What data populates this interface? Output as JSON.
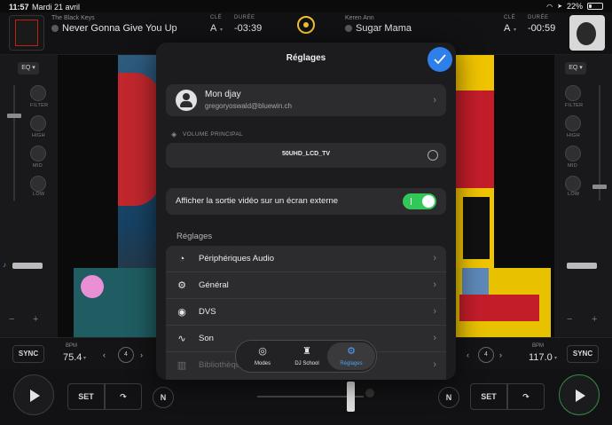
{
  "status": {
    "time": "11:57",
    "date": "Mardi 21 avril",
    "battery": "22%",
    "battery_level": 0.22
  },
  "deck_left": {
    "artist": "The Black Keys",
    "title": "Never Gonna Give You Up",
    "key_label": "CLÉ",
    "key": "A",
    "duration_label": "DURÉE",
    "duration": "-03:39",
    "eq_label": "EQ",
    "filter_label": "FILTER",
    "high_label": "HIGH",
    "mid_label": "MID",
    "low_label": "LOW",
    "sync_label": "SYNC",
    "bpm_label": "BPM",
    "bpm": "75.4",
    "loop": "4",
    "set_label": "SET",
    "n_label": "N"
  },
  "deck_right": {
    "artist": "Keren Ann",
    "title": "Sugar Mama",
    "key_label": "CLÉ",
    "key": "A",
    "duration_label": "DURÉE",
    "duration": "-00:59",
    "eq_label": "EQ",
    "filter_label": "FILTER",
    "high_label": "HIGH",
    "mid_label": "MID",
    "low_label": "LOW",
    "sync_label": "SYNC",
    "bpm_label": "BPM",
    "bpm": "117.0",
    "loop": "4",
    "set_label": "SET",
    "n_label": "N"
  },
  "settings": {
    "title": "Réglages",
    "account_name": "Mon djay",
    "account_email": "gregoryoswald@bluewin.ch",
    "volume_section": "VOLUME PRINCIPAL",
    "output_device": "50UHD_LCD_TV",
    "external_video_label": "Afficher la sortie vidéo sur un écran externe",
    "external_video_on": true,
    "settings_section": "Réglages",
    "items": [
      {
        "label": "Périphériques Audio",
        "icon": "audio-devices-icon"
      },
      {
        "label": "Général",
        "icon": "gear-icon"
      },
      {
        "label": "DVS",
        "icon": "turntable-icon"
      },
      {
        "label": "Son",
        "icon": "waveform-icon"
      },
      {
        "label": "Bibliothèque",
        "icon": "library-icon"
      }
    ]
  },
  "tabbar": {
    "tabs": [
      {
        "label": "Modes",
        "icon": "vinyl-icon",
        "active": false
      },
      {
        "label": "DJ School",
        "icon": "graduation-icon",
        "active": false
      },
      {
        "label": "Réglages",
        "icon": "gear-icon",
        "active": true
      }
    ]
  },
  "colors": {
    "accent": "#2f7fea",
    "toggle_on": "#33c759",
    "active_tab": "#4ea0f5"
  }
}
